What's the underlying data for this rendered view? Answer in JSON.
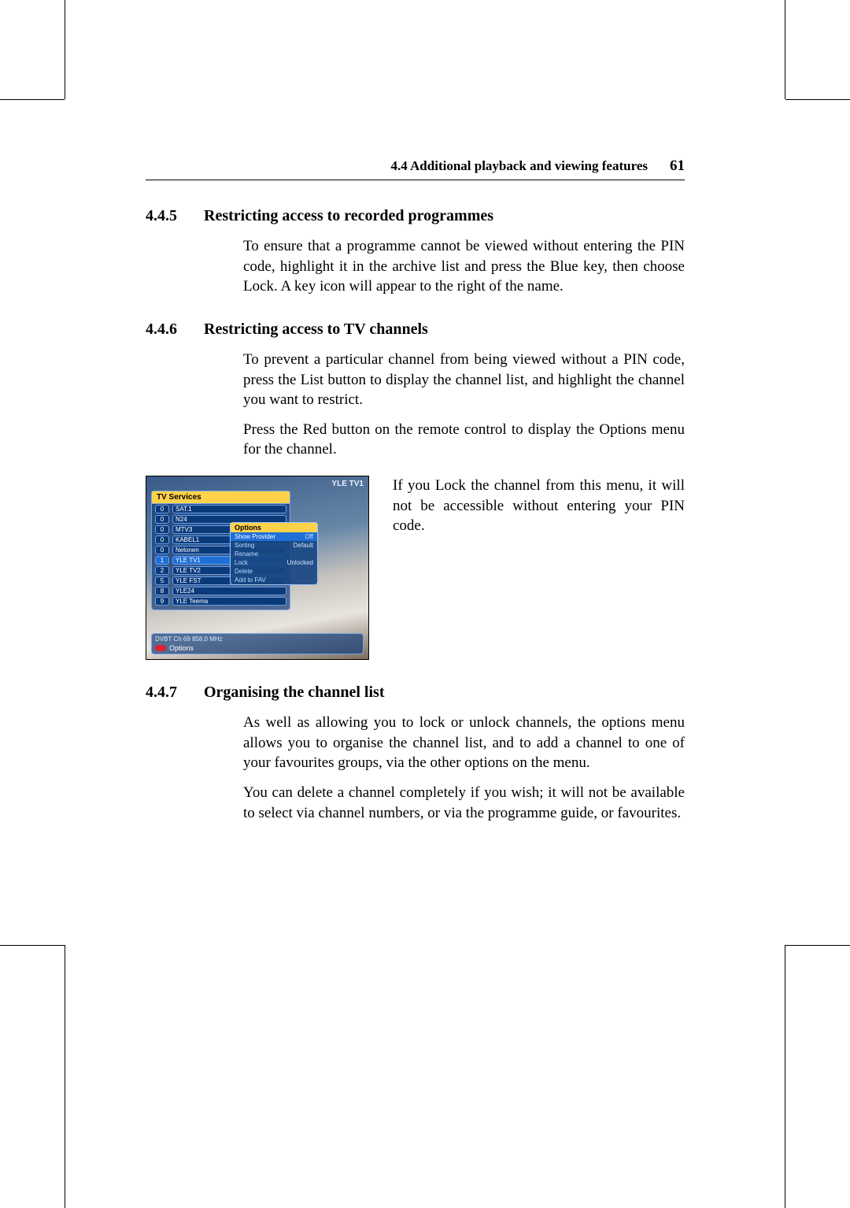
{
  "header": {
    "section": "4.4 Additional playback and viewing features",
    "page": "61"
  },
  "sec445": {
    "num": "4.4.5",
    "title": "Restricting access to recorded programmes",
    "p1": "To ensure that a programme cannot be viewed without entering the PIN code, highlight it in the archive list and press the Blue key, then choose Lock. A key icon will appear to the right of the name."
  },
  "sec446": {
    "num": "4.4.6",
    "title": "Restricting access to TV channels",
    "p1": "To prevent a particular channel from being viewed without a PIN code, press the List button to display the channel list, and highlight the channel you want to restrict.",
    "p2": "Press the Red button on the remote control to display the Options menu for the channel.",
    "aside": "If you Lock the channel from this menu, it will not be accessible without entering your PIN code."
  },
  "sec447": {
    "num": "4.4.7",
    "title": "Organising the channel list",
    "p1": "As well as allowing you to lock or unlock channels, the options menu allows you to organise the channel list, and to add a channel to one of your favourites groups, via the other options on the menu.",
    "p2": "You can delete a channel completely if you wish; it will not be available to select via channel numbers, or via the programme guide, or favourites."
  },
  "tv": {
    "logo": "YLE TV1",
    "panel_title": "TV Services",
    "channels": [
      {
        "num": "0",
        "name": "SAT.1"
      },
      {
        "num": "0",
        "name": "N24"
      },
      {
        "num": "0",
        "name": "MTV3"
      },
      {
        "num": "0",
        "name": "KABEL1"
      },
      {
        "num": "0",
        "name": "Nelonen"
      },
      {
        "num": "1",
        "name": "YLE TV1",
        "hl": true
      },
      {
        "num": "2",
        "name": "YLE TV2"
      },
      {
        "num": "5",
        "name": "YLE FST"
      },
      {
        "num": "8",
        "name": "YLE24"
      },
      {
        "num": "9",
        "name": "YLE Teema"
      }
    ],
    "opt_title": "Options",
    "options": [
      {
        "label": "Show Provider",
        "value": "Off",
        "hl": true
      },
      {
        "label": "Sorting",
        "value": "Default"
      },
      {
        "label": "Rename",
        "value": ""
      },
      {
        "label": "Lock",
        "value": "Unlocked"
      },
      {
        "label": "Delete",
        "value": ""
      },
      {
        "label": "Add to FAV",
        "value": ""
      }
    ],
    "foot1": "DVBT   Ch 69   858.0 MHz",
    "foot2": "Options"
  }
}
